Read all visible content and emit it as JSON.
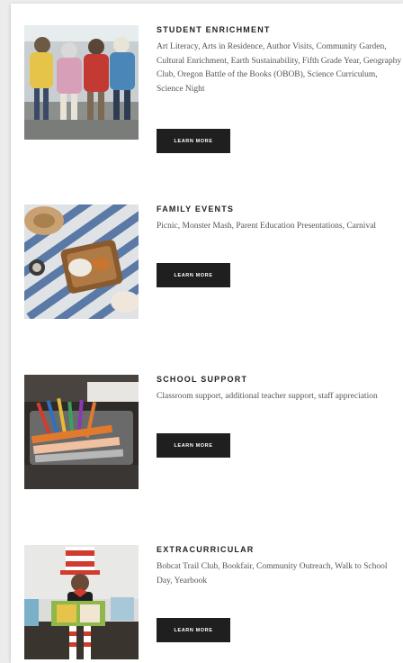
{
  "cards": [
    {
      "title": "STUDENT ENRICHMENT",
      "description": "Art Literacy, Arts in Residence, Author Visits, Community Garden, Cultural Enrichment, Earth Sustainability, Fifth Grade Year, Geography Club, Oregon Battle of the Books (OBOB), Science Curriculum, Science Night",
      "button": "LEARN MORE"
    },
    {
      "title": "FAMILY EVENTS",
      "description": "Picnic, Monster Mash, Parent Education Presentations, Carnival",
      "button": "LEARN MORE"
    },
    {
      "title": "SCHOOL SUPPORT",
      "description": "Classroom support, additional teacher support, staff appreciation",
      "button": "LEARN MORE"
    },
    {
      "title": "EXTRACURRICULAR",
      "description": "Bobcat Trail Club, Bookfair, Community Outreach, Walk to School Day, Yearbook",
      "button": "LEARN MORE"
    }
  ]
}
